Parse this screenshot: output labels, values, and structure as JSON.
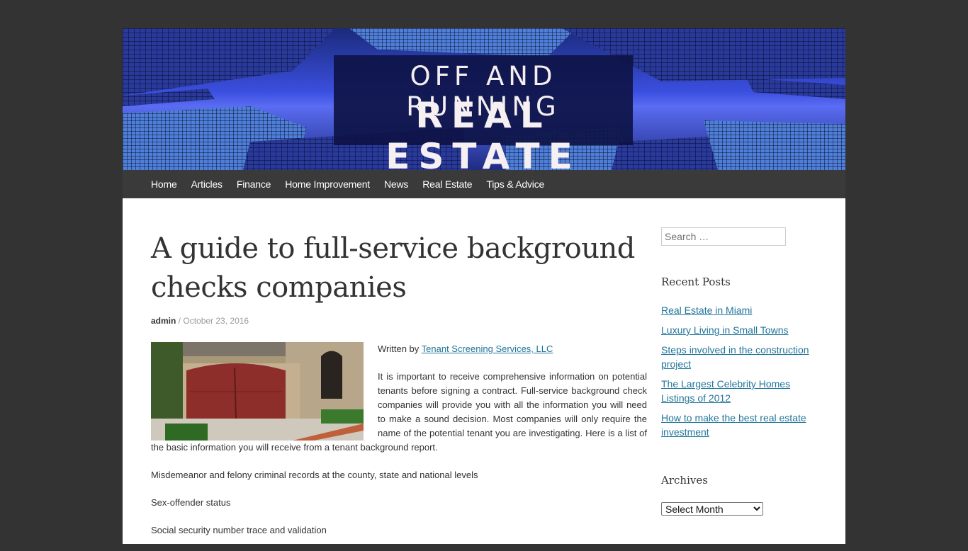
{
  "site": {
    "logo_line1": "OFF AND RUNNING",
    "logo_line2": "REAL ESTATE"
  },
  "nav": {
    "items": [
      {
        "label": "Home"
      },
      {
        "label": "Articles"
      },
      {
        "label": "Finance"
      },
      {
        "label": "Home Improvement"
      },
      {
        "label": "News"
      },
      {
        "label": "Real Estate"
      },
      {
        "label": "Tips & Advice"
      }
    ]
  },
  "post": {
    "title": "A guide to full-service background checks companies",
    "author": "admin",
    "separator": " / ",
    "date": "October 23, 2016",
    "written_by_prefix": "Written by ",
    "written_by_link": "Tenant Screening Services, LLC",
    "intro": "It is important to receive comprehensive information on potential tenants before signing a contract. Full-service background check companies will provide you with all the information you will need to make a sound decision. Most companies will only require the name of the potential tenant you are investigating. Here is a list of the basic information you will receive from a tenant background report.",
    "list_items": [
      "Misdemeanor and felony criminal records at the county, state and national levels",
      "Sex-offender status",
      "Social security number trace and validation"
    ]
  },
  "sidebar": {
    "search_placeholder": "Search …",
    "recent_posts_title": "Recent Posts",
    "recent_posts": [
      "Real Estate in Miami",
      "Luxury Living in Small Towns",
      "Steps involved in the construction project",
      "The Largest Celebrity Homes Listings of 2012",
      "How to make the best real estate investment"
    ],
    "archives_title": "Archives",
    "archives_selected": "Select Month"
  }
}
